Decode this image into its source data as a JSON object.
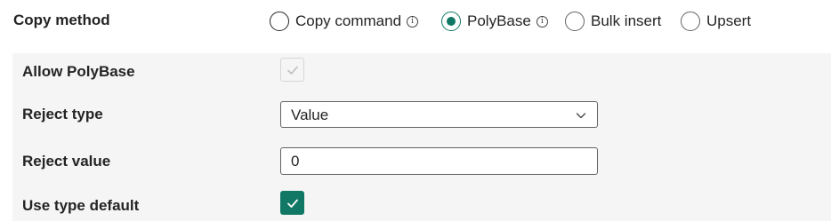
{
  "copy_method": {
    "label": "Copy method",
    "options": [
      {
        "label": "Copy command",
        "selected": false,
        "info": true
      },
      {
        "label": "PolyBase",
        "selected": true,
        "info": true
      },
      {
        "label": "Bulk insert",
        "selected": false,
        "info": false
      },
      {
        "label": "Upsert",
        "selected": false,
        "info": false
      }
    ],
    "info_glyph": "i"
  },
  "polybase": {
    "allow_label": "Allow PolyBase",
    "allow_checked": true,
    "allow_disabled": true,
    "reject_type_label": "Reject type",
    "reject_type_value": "Value",
    "reject_value_label": "Reject value",
    "reject_value": "0",
    "use_type_default_label": "Use type default",
    "use_type_default_checked": true
  },
  "colors": {
    "accent": "#117865",
    "panel_bg": "#f5f5f5",
    "text": "#242424"
  }
}
